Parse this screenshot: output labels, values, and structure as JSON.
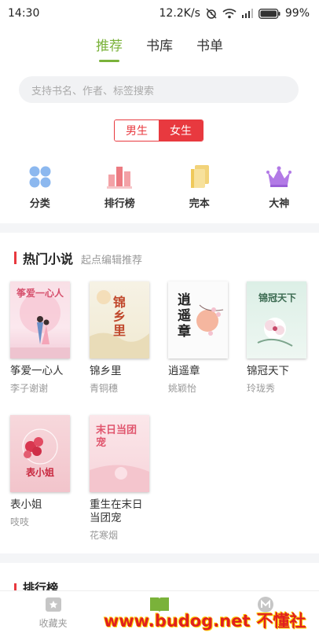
{
  "status_bar": {
    "time": "14:30",
    "speed": "12.2K/s",
    "battery": "99%"
  },
  "tabs": [
    {
      "label": "推荐",
      "active": true
    },
    {
      "label": "书库",
      "active": false
    },
    {
      "label": "书单",
      "active": false
    }
  ],
  "search": {
    "placeholder": "支持书名、作者、标签搜索"
  },
  "gender": {
    "male": "男生",
    "female": "女生",
    "selected": "女生"
  },
  "categories": [
    {
      "label": "分类",
      "icon": "grid-dots-icon"
    },
    {
      "label": "排行榜",
      "icon": "bar-rank-icon"
    },
    {
      "label": "完本",
      "icon": "book-stack-icon"
    },
    {
      "label": "大神",
      "icon": "crown-icon"
    }
  ],
  "hot_section": {
    "title": "热门小说",
    "subtitle": "起点编辑推荐"
  },
  "books": [
    {
      "title": "筝爱一心人",
      "author": "李子谢谢",
      "cover_text": "筝爱一心人"
    },
    {
      "title": "锦乡里",
      "author": "青铜穗",
      "cover_text": "锦乡里"
    },
    {
      "title": "逍遥章",
      "author": "姚颖怡",
      "cover_text": "逍遥章"
    },
    {
      "title": "锦冠天下",
      "author": "玲珑秀",
      "cover_text": "锦冠天下"
    },
    {
      "title": "表小姐",
      "author": "吱吱",
      "cover_text": "表小姐"
    },
    {
      "title": "重生在末日当团宠",
      "author": "花寒烟",
      "cover_text": "末日当团宠"
    }
  ],
  "next_section": {
    "title": "排行榜"
  },
  "bottom_nav": [
    {
      "label": "收藏夹",
      "icon": "bookshelf-icon",
      "active": false
    },
    {
      "label": "",
      "icon": "open-book-icon",
      "active": true
    },
    {
      "label": "",
      "icon": "m-badge-icon",
      "active": false
    }
  ],
  "watermark": {
    "site": "www.budog.net",
    "brand": "不懂社区"
  },
  "colors": {
    "accent_green": "#7ab23a",
    "accent_red": "#e8393f"
  }
}
